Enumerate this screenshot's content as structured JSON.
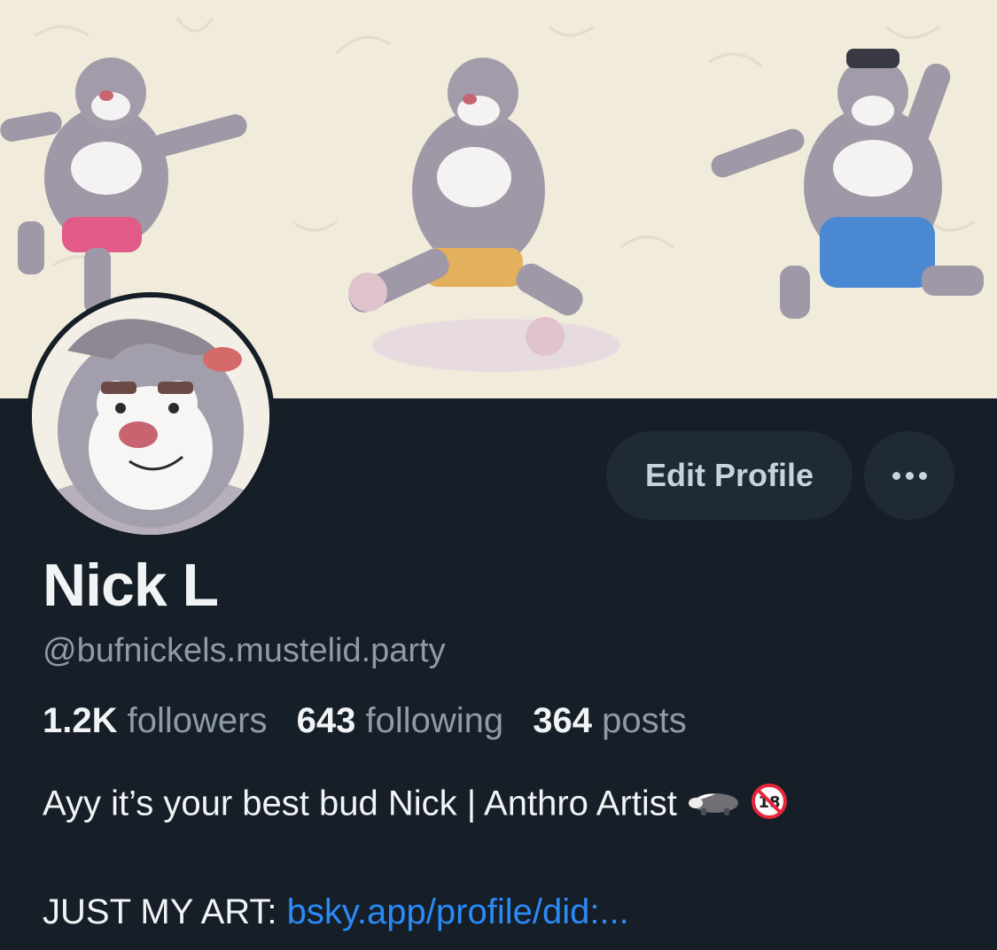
{
  "profile": {
    "display_name": "Nick L",
    "handle": "@bufnickels.mustelid.party",
    "stats": {
      "followers_count": "1.2K",
      "followers_label": "followers",
      "following_count": "643",
      "following_label": "following",
      "posts_count": "364",
      "posts_label": "posts"
    },
    "bio_line": "Ayy it’s your best bud Nick | Anthro Artist",
    "bio_emojis": [
      "badger-icon",
      "no-under-18-icon"
    ],
    "art_label": "JUST MY ART: ",
    "art_link": "bsky.app/profile/did:..."
  },
  "actions": {
    "edit_label": "Edit Profile",
    "more_icon": "more-dots-icon"
  },
  "theme": {
    "background": "#161e27",
    "button_bg": "#1f2a35",
    "muted_text": "#8f9ba8",
    "link": "#2a8af6",
    "banner_bg": "#f1ebdc"
  },
  "banner": {
    "subject": "cartoon badger artwork",
    "icon": "banner-image"
  },
  "avatar": {
    "icon": "avatar-image"
  }
}
